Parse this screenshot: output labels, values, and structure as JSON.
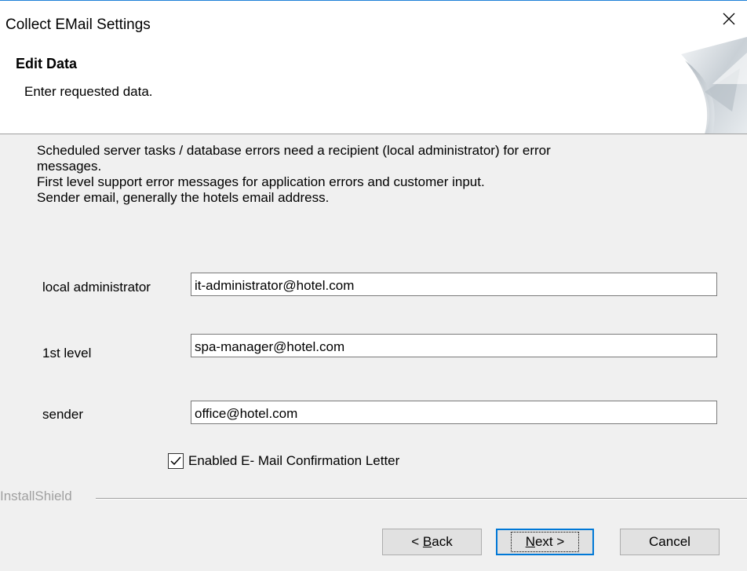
{
  "window": {
    "title": "Collect EMail Settings"
  },
  "header": {
    "title": "Edit Data",
    "subtitle": "Enter requested data."
  },
  "description": {
    "line1": "Scheduled server tasks  / database errors need a recipient (local administrator) for error",
    "line2": "messages.",
    "line3": "First level support error messages for application errors and customer input.",
    "line4": "Sender email, generally the hotels email address."
  },
  "fields": {
    "local_admin": {
      "label": "local administrator",
      "value": "it-administrator@hotel.com"
    },
    "first_level": {
      "label": "1st level",
      "value": "spa-manager@hotel.com"
    },
    "sender": {
      "label": "sender",
      "value": "office@hotel.com"
    }
  },
  "checkbox": {
    "label": "Enabled E- Mail Confirmation Letter",
    "checked": true
  },
  "footer": {
    "brand": "InstallShield"
  },
  "buttons": {
    "back": {
      "prefix": "< ",
      "accel": "B",
      "rest": "ack"
    },
    "next": {
      "accel": "N",
      "rest": "ext >"
    },
    "cancel": {
      "label": "Cancel"
    }
  }
}
